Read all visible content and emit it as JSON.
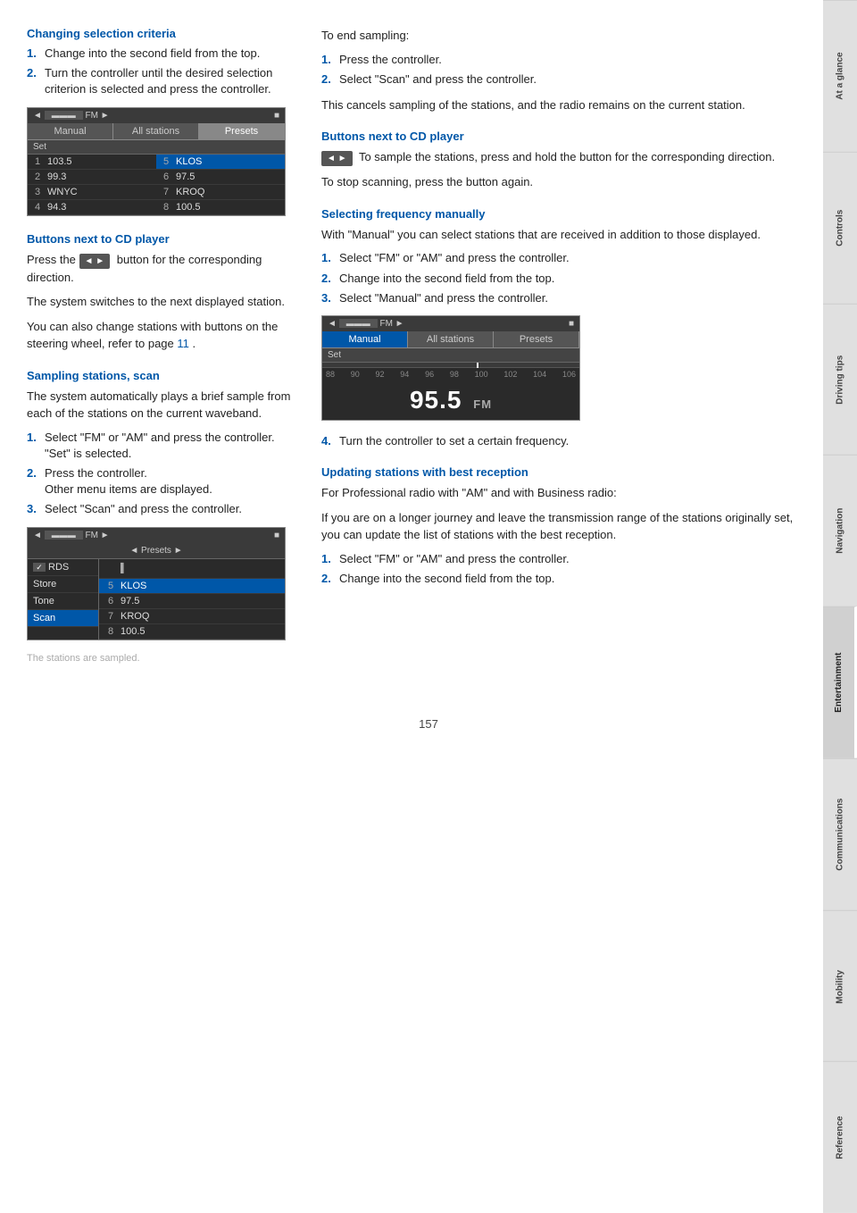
{
  "sidebar": {
    "tabs": [
      {
        "label": "At a glance",
        "active": false
      },
      {
        "label": "Controls",
        "active": false
      },
      {
        "label": "Driving tips",
        "active": false
      },
      {
        "label": "Navigation",
        "active": false
      },
      {
        "label": "Entertainment",
        "active": true
      },
      {
        "label": "Communications",
        "active": false
      },
      {
        "label": "Mobility",
        "active": false
      },
      {
        "label": "Reference",
        "active": false
      }
    ]
  },
  "page_number": "157",
  "left_col": {
    "section1_heading": "Changing selection criteria",
    "section1_steps": [
      "Change into the second field from the top.",
      "Turn the controller until the desired selection criterion is selected and press the controller."
    ],
    "radio1": {
      "top_left": "◄ [____] FM ►",
      "top_right": "■",
      "tabs": [
        "Manual",
        "All stations",
        "Presets"
      ],
      "active_tab": "Presets",
      "set_label": "Set",
      "stations": [
        {
          "num": "1",
          "freq": "103.5",
          "side": "left"
        },
        {
          "num": "5",
          "freq": "KLOS",
          "side": "right"
        },
        {
          "num": "2",
          "freq": "99.3",
          "side": "left"
        },
        {
          "num": "6",
          "freq": "97.5",
          "side": "right"
        },
        {
          "num": "3",
          "freq": "WNYC",
          "side": "left"
        },
        {
          "num": "7",
          "freq": "KROQ",
          "side": "right"
        },
        {
          "num": "4",
          "freq": "94.3",
          "side": "left"
        },
        {
          "num": "8",
          "freq": "100.5",
          "side": "right"
        }
      ]
    },
    "section2_heading": "Buttons next to CD player",
    "section2_para1": "Press the",
    "section2_btn": "◄ ►",
    "section2_para1b": "button for the corresponding direction.",
    "section2_para2": "The system switches to the next displayed station.",
    "section2_para3": "You can also change stations with buttons on the steering wheel, refer to page",
    "section2_link": "11",
    "section2_para3b": ".",
    "section3_heading": "Sampling stations, scan",
    "section3_para": "The system automatically plays a brief sample from each of the stations on the current waveband.",
    "section3_steps": [
      {
        "num": "1",
        "text": "Select \"FM\" or \"AM\" and press the controller. \"Set\" is selected."
      },
      {
        "num": "2",
        "text": "Press the controller. Other menu items are displayed."
      },
      {
        "num": "3",
        "text": "Select \"Scan\" and press the controller."
      }
    ],
    "scan_radio": {
      "top": "◄ [____] FM ►",
      "top_right": "■",
      "presets": "◄ Presets ►",
      "menu_items": [
        "✓ RDS",
        "Store",
        "Tone",
        "Scan"
      ],
      "active_menu": "Scan",
      "stations_right": [
        {
          "freq": "5 KLOS"
        },
        {
          "freq": "6 97.5"
        },
        {
          "freq": "7 KROQ"
        },
        {
          "freq": "8 100.5"
        }
      ]
    },
    "scan_caption": "The stations are sampled."
  },
  "right_col": {
    "sampling_end_heading": "To end sampling:",
    "sampling_end_steps": [
      "Press the controller.",
      "Select \"Scan\" and press the controller."
    ],
    "sampling_end_note": "This cancels sampling of the stations, and the radio remains on the current station.",
    "section_cd_heading": "Buttons next to CD player",
    "section_cd_note_icon": "◄ ►",
    "section_cd_para1": "To sample the stations, press and hold the button for the corresponding direction.",
    "section_cd_para2": "To stop scanning, press the button again.",
    "section_freq_heading": "Selecting frequency manually",
    "section_freq_para": "With \"Manual\" you can select stations that are received in addition to those displayed.",
    "section_freq_steps": [
      {
        "num": "1",
        "text": "Select \"FM\" or \"AM\" and press the controller."
      },
      {
        "num": "2",
        "text": "Change into the second field from the top."
      },
      {
        "num": "3",
        "text": "Select \"Manual\" and press the controller."
      }
    ],
    "manual_radio": {
      "top": "◄ [____] FM ►",
      "top_right": "■",
      "tabs": [
        "Manual",
        "All stations",
        "Presets"
      ],
      "active_tab": "Manual",
      "set_label": "Set",
      "freq_display": "95.5",
      "freq_unit": "FM",
      "scale": [
        "88",
        "90",
        "92",
        "94",
        "96",
        "98",
        "100",
        "102",
        "104",
        "106"
      ]
    },
    "section_freq_step4": {
      "num": "4",
      "text": "Turn the controller to set a certain frequency."
    },
    "section_update_heading": "Updating stations with best reception",
    "section_update_para1": "For Professional radio with \"AM\" and with Business radio:",
    "section_update_para2": "If you are on a longer journey and leave the transmission range of the stations originally set, you can update the list of stations with the best reception.",
    "section_update_steps": [
      {
        "num": "1",
        "text": "Select \"FM\" or \"AM\" and press the controller."
      },
      {
        "num": "2",
        "text": "Change into the second field from the top."
      }
    ]
  }
}
